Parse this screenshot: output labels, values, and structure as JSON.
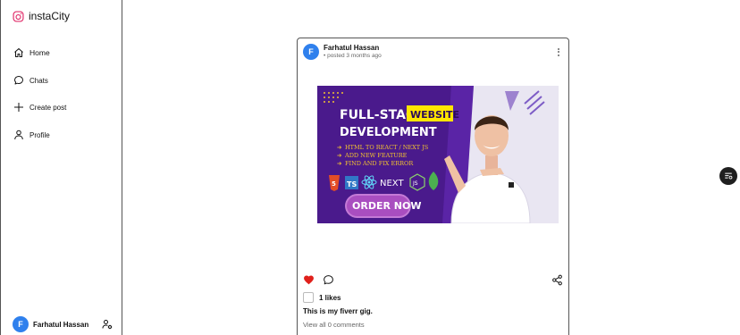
{
  "app": {
    "name": "instaCity"
  },
  "nav": [
    {
      "label": "Home",
      "icon": "home-icon"
    },
    {
      "label": "Chats",
      "icon": "chat-icon"
    },
    {
      "label": "Create post",
      "icon": "plus-icon"
    },
    {
      "label": "Profile",
      "icon": "user-icon"
    }
  ],
  "current_user": {
    "initial": "F",
    "name": "Farhatul Hassan"
  },
  "post": {
    "author_initial": "F",
    "author": "Farhatul Hassan",
    "time": "• posted 3 months ago",
    "likes": "1 likes",
    "caption": "This is my fiverr gig.",
    "comments_link": "View all 0 comments",
    "banner": {
      "line1": "FULL-STACK",
      "badge": "WEBSITE",
      "line2": "DEVELOPMENT",
      "bullets": [
        "HTML  TO  REACT / NEXT JS",
        "ADD NEW FEATURE",
        "FIND AND FIX ERROR"
      ],
      "tech": [
        "TS",
        "NEXT",
        "JS"
      ],
      "cta": "ORDER NOW"
    }
  },
  "colors": {
    "brand": "#e1306c",
    "avatar": "#2f80ed",
    "like": "#e0201b",
    "banner_bg": "#4a1a8c",
    "badge": "#ffe600"
  }
}
